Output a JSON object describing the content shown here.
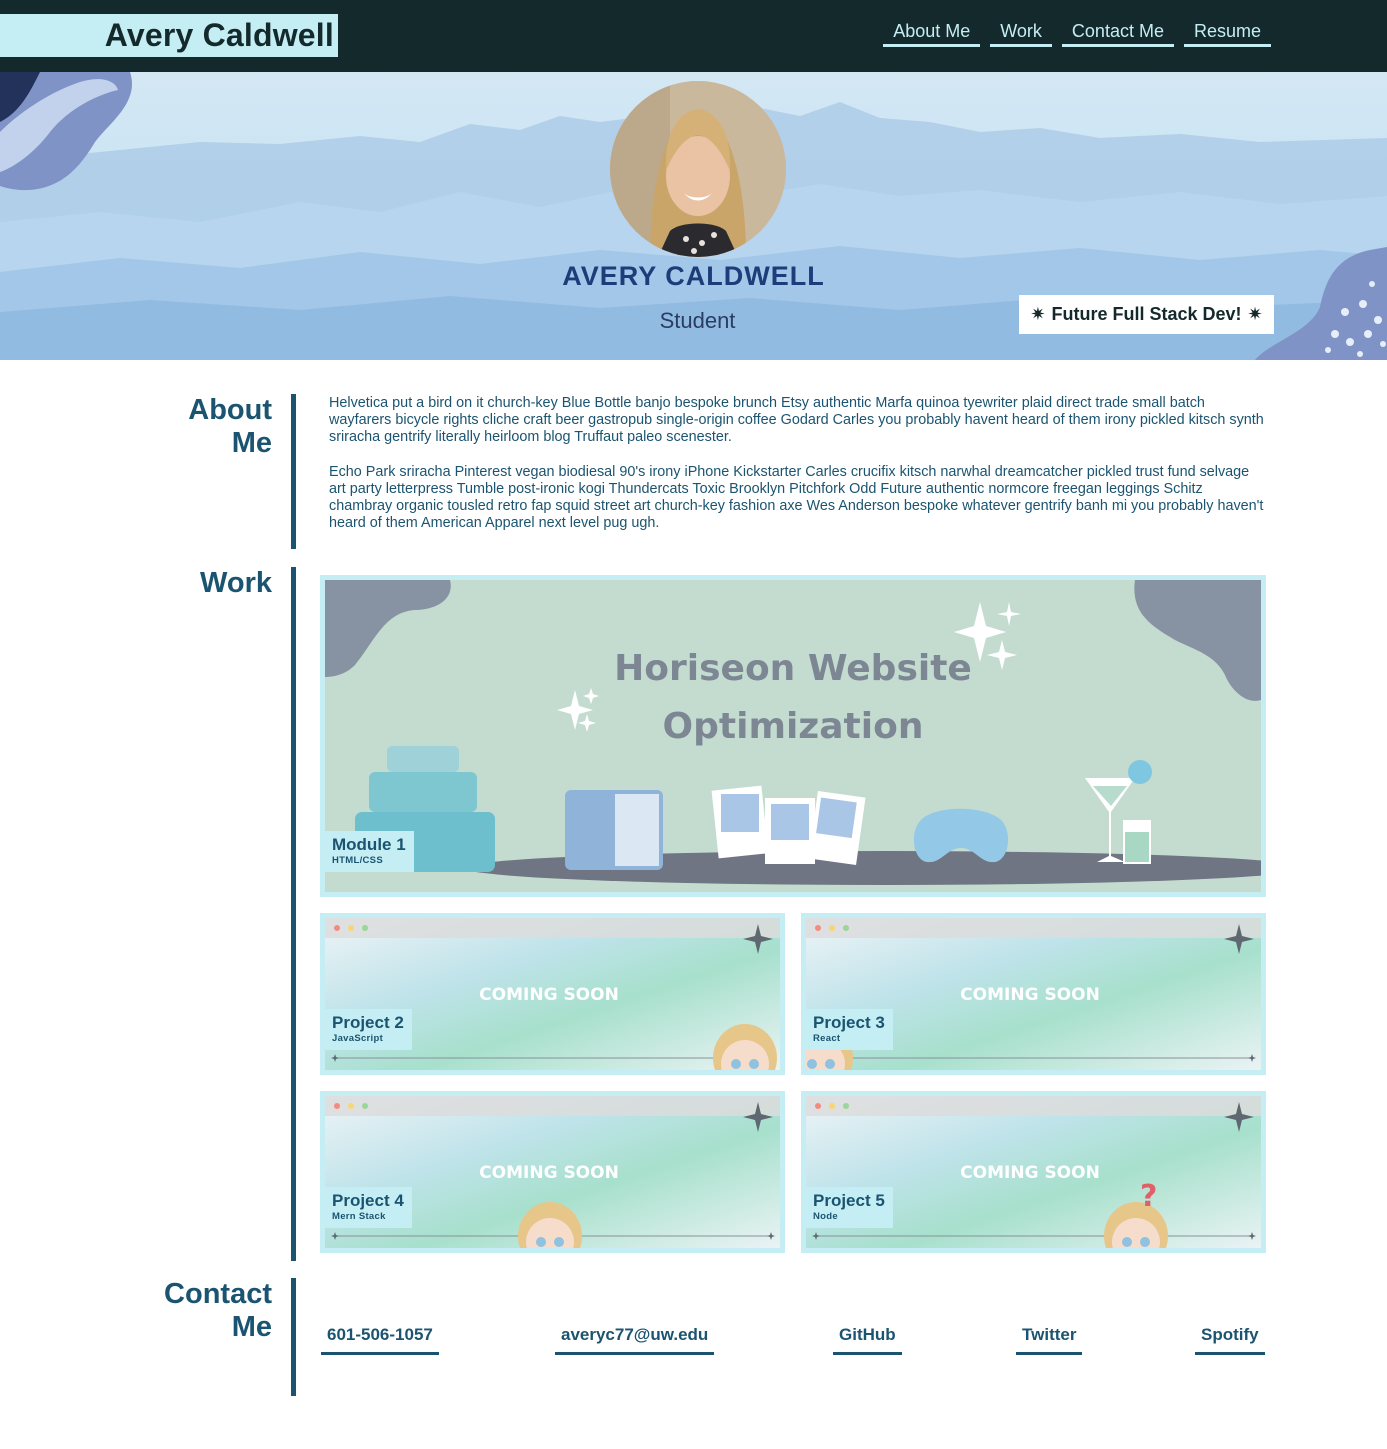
{
  "header": {
    "brand": "Avery Caldwell",
    "nav": [
      "About Me",
      "Work",
      "Contact Me",
      "Resume"
    ]
  },
  "hero": {
    "name": "AVERY CALDWELL",
    "role": "Student",
    "badge": {
      "text": "Future Full Stack Dev!",
      "icon": "sparkle-icon"
    }
  },
  "about": {
    "title_line1": "About",
    "title_line2": "Me",
    "paragraphs": [
      "Helvetica put a bird on it church-key Blue Bottle banjo bespoke brunch Etsy authentic Marfa quinoa tyewriter plaid direct trade small batch wayfarers bicycle rights cliche craft beer gastropub single-origin coffee Godard Carles you probably havent heard of them irony pickled kitsch synth sriracha gentrify literally heirloom blog Truffaut paleo scenester.",
      "Echo Park sriracha Pinterest vegan biodiesal 90's irony iPhone Kickstarter Carles crucifix kitsch narwhal dreamcatcher pickled trust fund selvage art party letterpress Tumble post-ironic kogi Thundercats Toxic Brooklyn Pitchfork Odd Future authentic normcore freegan leggings Schitz chambray organic tousled retro fap squid street art church-key fashion axe Wes Anderson bespoke whatever gentrify banh mi you probably haven't heard of them American Apparel next level pug ugh."
    ]
  },
  "work": {
    "title": "Work",
    "featured": {
      "image_text_line1": "Horiseon Website",
      "image_text_line2": "Optimization",
      "title": "Module 1",
      "subtitle": "HTML/CSS"
    },
    "coming_soon_text": "COMING SOON",
    "projects": [
      {
        "title": "Project 2",
        "subtitle": "JavaScript"
      },
      {
        "title": "Project 3",
        "subtitle": "React"
      },
      {
        "title": "Project 4",
        "subtitle": "Mern Stack"
      },
      {
        "title": "Project 5",
        "subtitle": "Node"
      }
    ]
  },
  "contact": {
    "title_line1": "Contact",
    "title_line2": "Me",
    "links": [
      "601-506-1057",
      "averyc77@uw.edu",
      "GitHub",
      "Twitter",
      "Spotify"
    ]
  },
  "colors": {
    "header_bg": "#14292b",
    "accent_light": "#c4eef4",
    "primary_text": "#1b5470",
    "hero_name": "#1e3c7a"
  }
}
